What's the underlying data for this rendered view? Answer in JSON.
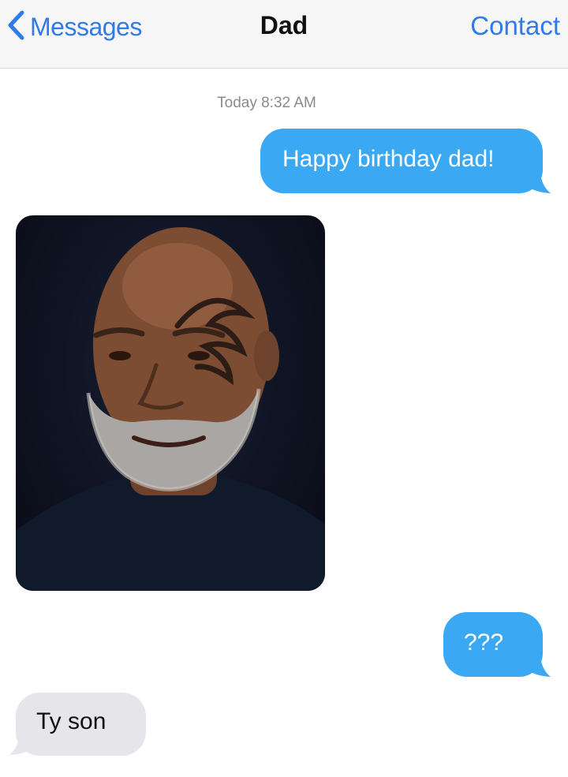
{
  "header": {
    "back_label": "Messages",
    "title": "Dad",
    "contact_label": "Contact"
  },
  "thread": {
    "timestamp": "Today 8:32 AM",
    "messages": [
      {
        "direction": "outgoing",
        "type": "text",
        "text": "Happy birthday dad!"
      },
      {
        "direction": "incoming",
        "type": "image"
      },
      {
        "direction": "outgoing",
        "type": "text",
        "text": "???"
      },
      {
        "direction": "incoming",
        "type": "text",
        "text": "Ty son"
      }
    ]
  },
  "colors": {
    "accent": "#2f7be9",
    "outgoing_bubble": "#3ba8f4",
    "incoming_bubble": "#e6e6ea",
    "nav_background": "#f6f6f6"
  },
  "icons": {
    "back": "chevron-left-icon"
  }
}
